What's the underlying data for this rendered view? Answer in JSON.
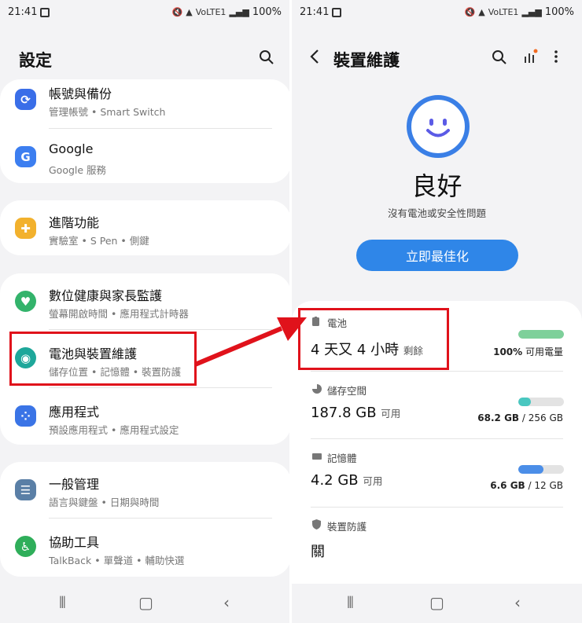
{
  "left": {
    "status": {
      "time": "21:41",
      "battery": "100%",
      "net": "VoLTE1"
    },
    "title": "設定",
    "items": [
      {
        "title": "帳號與備份",
        "sub": "管理帳號 • Smart Switch",
        "icon": "sync-icon",
        "color": "#3a6ee8"
      },
      {
        "title": "Google",
        "sub": "Google 服務",
        "icon": "google-icon",
        "color": "#3c7ef0"
      },
      {
        "title": "進階功能",
        "sub": "實驗室 • S Pen • 側鍵",
        "icon": "puzzle-icon",
        "color": "#f2b12d"
      },
      {
        "title": "數位健康與家長監護",
        "sub": "螢幕開啟時間 • 應用程式計時器",
        "icon": "wellbeing-icon",
        "color": "#33b36b"
      },
      {
        "title": "電池與裝置維護",
        "sub": "儲存位置 • 記憶體 • 裝置防護",
        "icon": "device-care-icon",
        "color": "#1ea79a"
      },
      {
        "title": "應用程式",
        "sub": "預設應用程式 • 應用程式設定",
        "icon": "apps-icon",
        "color": "#3a74e6"
      },
      {
        "title": "一般管理",
        "sub": "語言與鍵盤 • 日期與時間",
        "icon": "sliders-icon",
        "color": "#5a7fa6"
      },
      {
        "title": "協助工具",
        "sub": "TalkBack • 單聲道 • 輔助快選",
        "icon": "accessibility-icon",
        "color": "#2fae5a"
      }
    ]
  },
  "right": {
    "status": {
      "time": "21:41",
      "battery": "100%",
      "net": "VoLTE1"
    },
    "title": "裝置維護",
    "state": "良好",
    "state_sub": "沒有電池或安全性問題",
    "optimize": "立即最佳化",
    "rows": [
      {
        "label": "電池",
        "value": "4 天又 4 小時",
        "unit": "剩餘",
        "bar_text_bold": "100%",
        "bar_text_rest": " 可用電量",
        "fill": 1.0,
        "color": "#7ed09a"
      },
      {
        "label": "儲存空間",
        "value": "187.8 GB",
        "unit": "可用",
        "bar_text_bold": "68.2 GB",
        "bar_text_rest": " / 256 GB",
        "fill": 0.27,
        "color": "#49c7c0"
      },
      {
        "label": "記憶體",
        "value": "4.2 GB",
        "unit": "可用",
        "bar_text_bold": "6.6 GB",
        "bar_text_rest": " / 12 GB",
        "fill": 0.55,
        "color": "#4b8ee8"
      },
      {
        "label": "裝置防護",
        "value": "關",
        "unit": ""
      }
    ]
  }
}
